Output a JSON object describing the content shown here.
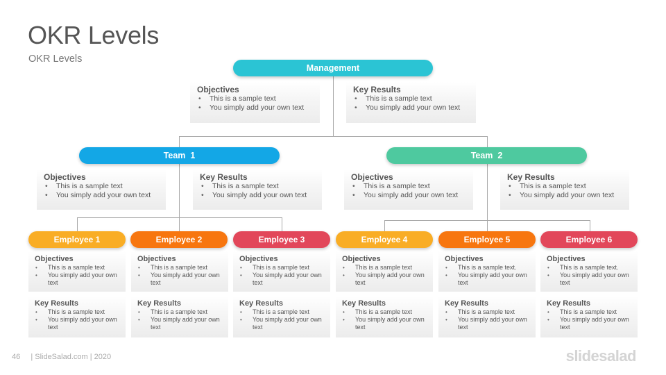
{
  "header": {
    "title": "OKR Levels",
    "subtitle": "OKR Levels"
  },
  "colors": {
    "management": "#2bc4d4",
    "team1": "#13a7e6",
    "team2": "#4ec99f",
    "employee_yellow": "#f9ad25",
    "employee_orange": "#f7760f",
    "employee_red": "#e2475a",
    "connector": "#a8a8a8"
  },
  "management": {
    "label": "Management",
    "objectives": {
      "heading": "Objectives",
      "items": [
        "This is a sample text",
        "You simply add your own text"
      ]
    },
    "key_results": {
      "heading": "Key Results",
      "items": [
        "This is a sample text",
        "You simply add your own text"
      ]
    }
  },
  "teams": [
    {
      "label": "Team  1",
      "objectives": {
        "heading": "Objectives",
        "items": [
          "This is a sample text",
          "You simply add your own text"
        ]
      },
      "key_results": {
        "heading": "Key Results",
        "items": [
          "This is a sample text",
          "You simply add your own text"
        ]
      }
    },
    {
      "label": "Team  2",
      "objectives": {
        "heading": "Objectives",
        "items": [
          "This is a sample text",
          "You simply add your own text"
        ]
      },
      "key_results": {
        "heading": "Key Results",
        "items": [
          "This is a sample text",
          "You simply add your own text"
        ]
      }
    }
  ],
  "employees": [
    {
      "label": "Employee 1",
      "objectives": {
        "heading": "Objectives",
        "items": [
          "This is a sample text",
          "You simply add your own text"
        ]
      },
      "key_results": {
        "heading": "Key Results",
        "items": [
          "This is a sample text",
          "You simply add your own text"
        ]
      }
    },
    {
      "label": "Employee 2",
      "objectives": {
        "heading": "Objectives",
        "items": [
          "This is a sample text",
          "You simply add your own text"
        ]
      },
      "key_results": {
        "heading": "Key Results",
        "items": [
          "This is a sample text",
          "You simply add your own text"
        ]
      }
    },
    {
      "label": "Employee 3",
      "objectives": {
        "heading": "Objectives",
        "items": [
          "This is a sample text",
          "You simply add your own text"
        ]
      },
      "key_results": {
        "heading": "Key Results",
        "items": [
          "This is a sample text",
          "You simply add your own text"
        ]
      }
    },
    {
      "label": "Employee 4",
      "objectives": {
        "heading": "Objectives",
        "items": [
          "This is a sample text",
          "You simply add your own text"
        ]
      },
      "key_results": {
        "heading": "Key Results",
        "items": [
          "This is a sample text",
          "You simply add your own text"
        ]
      }
    },
    {
      "label": "Employee 5",
      "objectives": {
        "heading": "Objectives",
        "items": [
          "This is a sample text.",
          "You simply add your own text"
        ]
      },
      "key_results": {
        "heading": "Key Results",
        "items": [
          "This is a sample text",
          "You simply add your own text"
        ]
      }
    },
    {
      "label": "Employee 6",
      "objectives": {
        "heading": "Objectives",
        "items": [
          "This is a sample text.",
          "You simply add your own text"
        ]
      },
      "key_results": {
        "heading": "Key Results",
        "items": [
          "This is a sample text",
          "You simply add your own text"
        ]
      }
    }
  ],
  "footer": {
    "page_number": "46",
    "credit": "| SlideSalad.com | 2020",
    "brand": "slidesalad"
  }
}
